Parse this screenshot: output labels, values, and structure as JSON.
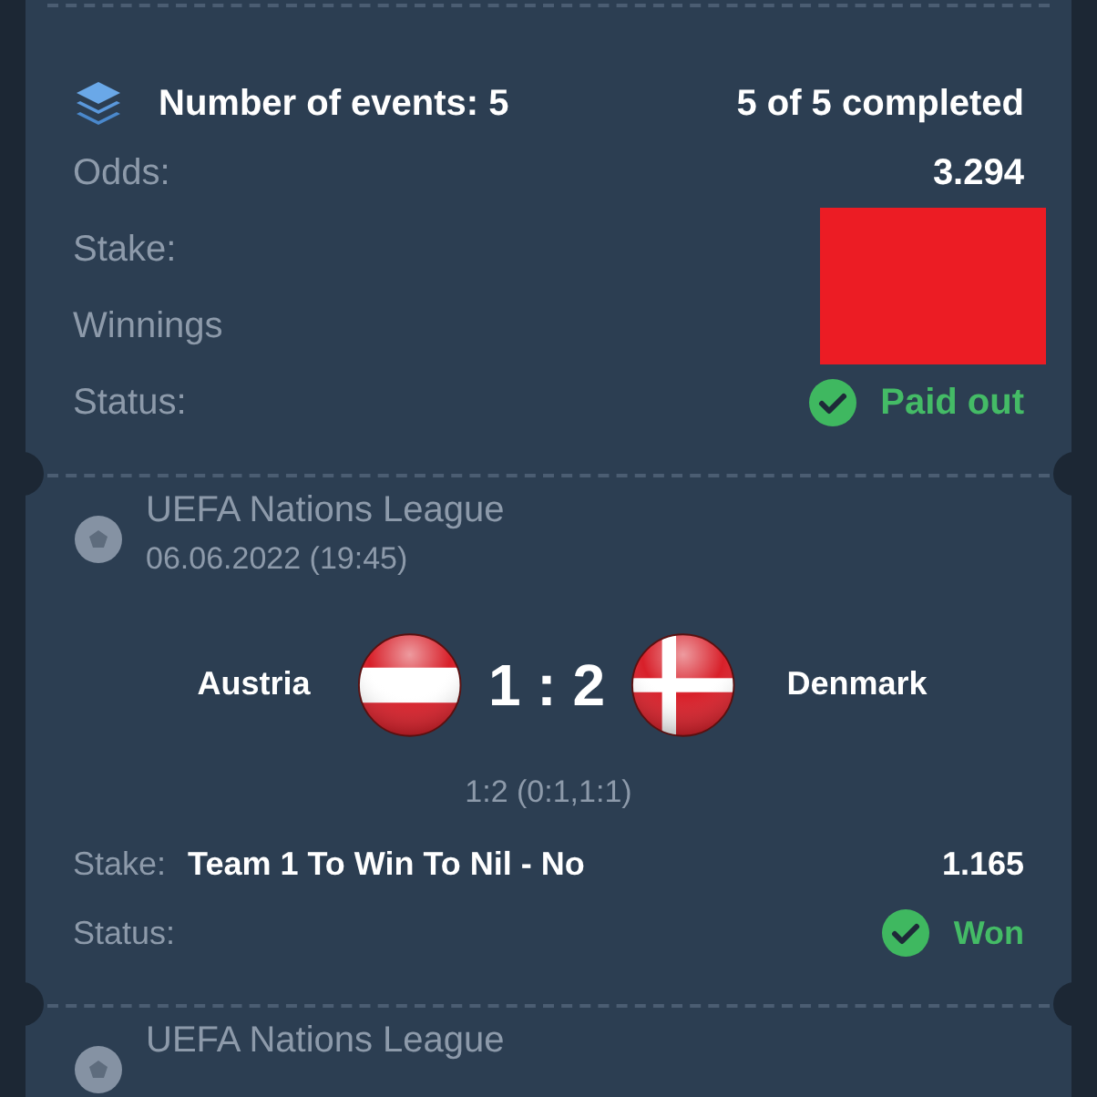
{
  "summary": {
    "title": "Number of events: 5",
    "progress": "5 of 5 completed",
    "rows": [
      {
        "label": "Odds:",
        "value": "3.294"
      },
      {
        "label": "Stake:"
      },
      {
        "label": "Winnings"
      },
      {
        "label": "Status:",
        "status": "Paid out",
        "success": true
      }
    ]
  },
  "events": [
    {
      "league": "UEFA Nations League",
      "date": "06.06.2022 (19:45)",
      "team1": "Austria",
      "flag1": {
        "kind": "austria"
      },
      "score": "1 : 2",
      "team2": "Denmark",
      "flag2": {
        "kind": "denmark"
      },
      "detail": "1:2 (0:1,1:1)",
      "stake_label": "Stake:",
      "bet": "Team 1 To Win To Nil - No",
      "odds": "1.165",
      "status_label": "Status:",
      "status": "Won",
      "won": true
    },
    {
      "league": "UEFA Nations League"
    }
  ]
}
